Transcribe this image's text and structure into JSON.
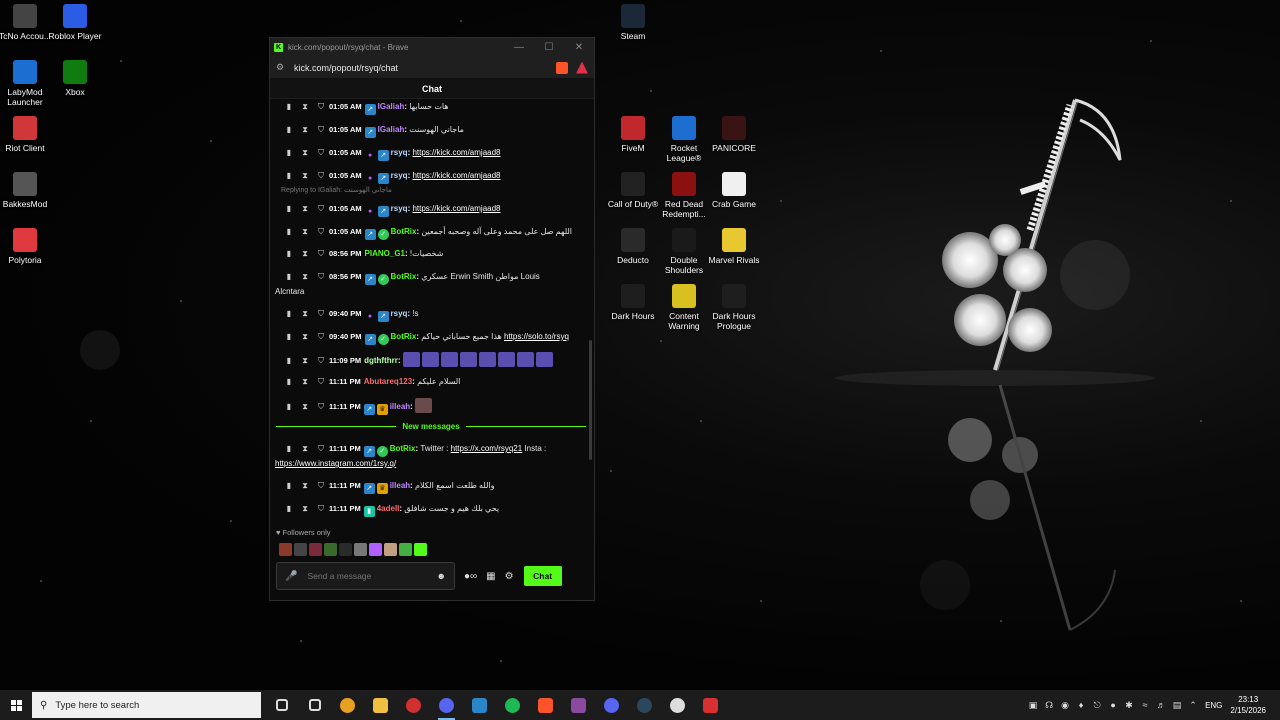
{
  "desktop_icons": [
    {
      "label": "TcNo Accou...",
      "icon": "tcno-icon",
      "color": "#444444"
    },
    {
      "label": "Roblox Player",
      "icon": "roblox-icon",
      "color": "#2b5ce6"
    },
    {
      "label": "LabyMod Launcher",
      "icon": "labymod-icon",
      "color": "#1a6fd0"
    },
    {
      "label": "Xbox",
      "icon": "xbox-icon",
      "color": "#107c10"
    },
    {
      "label": "Riot Client",
      "icon": "riot-icon",
      "color": "#d13639"
    },
    {
      "label": "BakkesMod",
      "icon": "bakkesmod-icon",
      "color": "#555555"
    },
    {
      "label": "Polytoria",
      "icon": "polytoria-icon",
      "color": "#e0393e"
    },
    {
      "label": "Steam",
      "icon": "steam-icon",
      "color": "#1b2838"
    },
    {
      "label": "FiveM",
      "icon": "fivem-icon",
      "color": "#c0282d"
    },
    {
      "label": "Rocket League®",
      "icon": "rocket-league-icon",
      "color": "#1c6fd0"
    },
    {
      "label": "PANICORE",
      "icon": "panicore-icon",
      "color": "#3a1414"
    },
    {
      "label": "Call of Duty®",
      "icon": "call-of-duty-icon",
      "color": "#222222"
    },
    {
      "label": "Red Dead Redempti...",
      "icon": "red-dead-icon",
      "color": "#8b1010"
    },
    {
      "label": "Crab Game",
      "icon": "crab-game-icon",
      "color": "#f0f0f0"
    },
    {
      "label": "Deducto",
      "icon": "deducto-icon",
      "color": "#2a2a2a"
    },
    {
      "label": "Double Shoulders",
      "icon": "double-shoulders-icon",
      "color": "#1a1a1a"
    },
    {
      "label": "Marvel Rivals",
      "icon": "marvel-rivals-icon",
      "color": "#e8c830"
    },
    {
      "label": "Dark Hours",
      "icon": "dark-hours-icon",
      "color": "#1e1e1e"
    },
    {
      "label": "Content Warning",
      "icon": "content-warning-icon",
      "color": "#d8c020"
    },
    {
      "label": "Dark Hours Prologue",
      "icon": "dark-hours-prologue-icon",
      "color": "#1e1e1e"
    }
  ],
  "browser": {
    "title": "kick.com/popout/rsyq/chat - Brave",
    "url": "kick.com/popout/rsyq/chat",
    "chat_header": "Chat"
  },
  "messages": [
    {
      "time": "01:05 AM",
      "user": "IGaliah",
      "user_color": "#c186ff",
      "text": "هات حسابها",
      "badges": [
        "og"
      ]
    },
    {
      "time": "01:05 AM",
      "user": "IGaliah",
      "user_color": "#c186ff",
      "text": "ماجاني الهوسنت",
      "badges": [
        "og"
      ]
    },
    {
      "time": "01:05 AM",
      "user": "rsyq",
      "user_color": "#b8d7ff",
      "link": "https://kick.com/amjaad8",
      "badges": [
        "mic",
        "og"
      ]
    },
    {
      "time": "01:05 AM",
      "user": "rsyq",
      "user_color": "#b8d7ff",
      "link": "https://kick.com/amjaad8",
      "badges": [
        "mic",
        "og"
      ]
    },
    {
      "reply": "Replying to IGaliah: ماجاني الهوسنت",
      "time": "01:05 AM",
      "user": "rsyq",
      "user_color": "#b8d7ff",
      "link": "https://kick.com/amjaad8",
      "badges": [
        "mic",
        "og"
      ]
    },
    {
      "time": "01:05 AM",
      "user": "BotRix",
      "user_color": "#53fc18",
      "text": "اللهم صل على محمد وعلى آله وصحبه أجمعين",
      "badges": [
        "og",
        "bot"
      ]
    },
    {
      "time": "08:56 PM",
      "user": "PIANO_G1",
      "user_color": "#53fc18",
      "text": "!شخصيات",
      "badges": []
    },
    {
      "time": "08:56 PM",
      "user": "BotRix",
      "user_color": "#53fc18",
      "text": "عسكري Erwin Smith مواطن Louis",
      "text2": "Alcntara",
      "badges": [
        "og",
        "bot"
      ]
    },
    {
      "time": "09:40 PM",
      "user": "rsyq",
      "user_color": "#b8d7ff",
      "text": "!s",
      "badges": [
        "mic",
        "og"
      ]
    },
    {
      "time": "09:40 PM",
      "user": "BotRix",
      "user_color": "#53fc18",
      "text": "هذا جميع حساباتي حياكم",
      "link": "https://solo.to/rsyq",
      "badges": [
        "og",
        "bot"
      ]
    },
    {
      "time": "11:09 PM",
      "user": "dgthfthrr",
      "user_color": "#b8ffb0",
      "emotes": 8,
      "badges": []
    },
    {
      "time": "11:11 PM",
      "user": "Abutareq123",
      "user_color": "#ff6a6a",
      "text": "السلام عليكم",
      "badges": []
    },
    {
      "time": "11:11 PM",
      "user": "illeah",
      "user_color": "#c186ff",
      "emotes": 1,
      "badges": [
        "og",
        "crown"
      ]
    }
  ],
  "new_messages_label": "New messages",
  "new_messages": [
    {
      "time": "11:11 PM",
      "user": "BotRix",
      "user_color": "#53fc18",
      "text": "Twitter :",
      "link": "https://x.com/rsyq21",
      "text_after": "Insta :",
      "link2": "https://www.instagram.com/1rsy.q/",
      "badges": [
        "og",
        "bot"
      ]
    },
    {
      "time": "11:11 PM",
      "user": "illeah",
      "user_color": "#c186ff",
      "text": "والله طلعت اسمع الكلام",
      "badges": [
        "og",
        "crown"
      ]
    },
    {
      "time": "11:11 PM",
      "user": "4adell",
      "user_color": "#ff6a6a",
      "text": "يحي بلك هيم و جست شافلق",
      "badges": [
        "sub"
      ]
    }
  ],
  "followers_label": "Followers only",
  "followers_avatar_colors": [
    "#8a3a2a",
    "#444444",
    "#7a2a3a",
    "#3a6a2a",
    "#2a2a2a",
    "#777777",
    "#b060ff",
    "#c0a080",
    "#44b044",
    "#53fc18"
  ],
  "input_placeholder": "Send a message",
  "chat_button": "Chat",
  "taskbar": {
    "search_placeholder": "Type here to search",
    "apps": [
      {
        "name": "task-view-icon",
        "color": "#dddddd"
      },
      {
        "name": "settings-icon",
        "color": "#dddddd"
      },
      {
        "name": "chrome-icon",
        "color": "#e8a020"
      },
      {
        "name": "file-explorer-icon",
        "color": "#f0c040"
      },
      {
        "name": "recorder-icon",
        "color": "#d03030"
      },
      {
        "name": "discord-active-icon",
        "color": "#5865f2"
      },
      {
        "name": "app-window-icon",
        "color": "#2a86c9"
      },
      {
        "name": "spotify-icon",
        "color": "#1db954"
      },
      {
        "name": "brave-icon",
        "color": "#fb542b"
      },
      {
        "name": "winrar-icon",
        "color": "#8a4aa0"
      },
      {
        "name": "discord-icon",
        "color": "#5865f2"
      },
      {
        "name": "steam-icon",
        "color": "#2a475e"
      },
      {
        "name": "github-icon",
        "color": "#dddddd"
      },
      {
        "name": "game-icon",
        "color": "#d83030"
      }
    ],
    "language": "ENG",
    "time": "23:13",
    "date": "2/15/2026"
  }
}
